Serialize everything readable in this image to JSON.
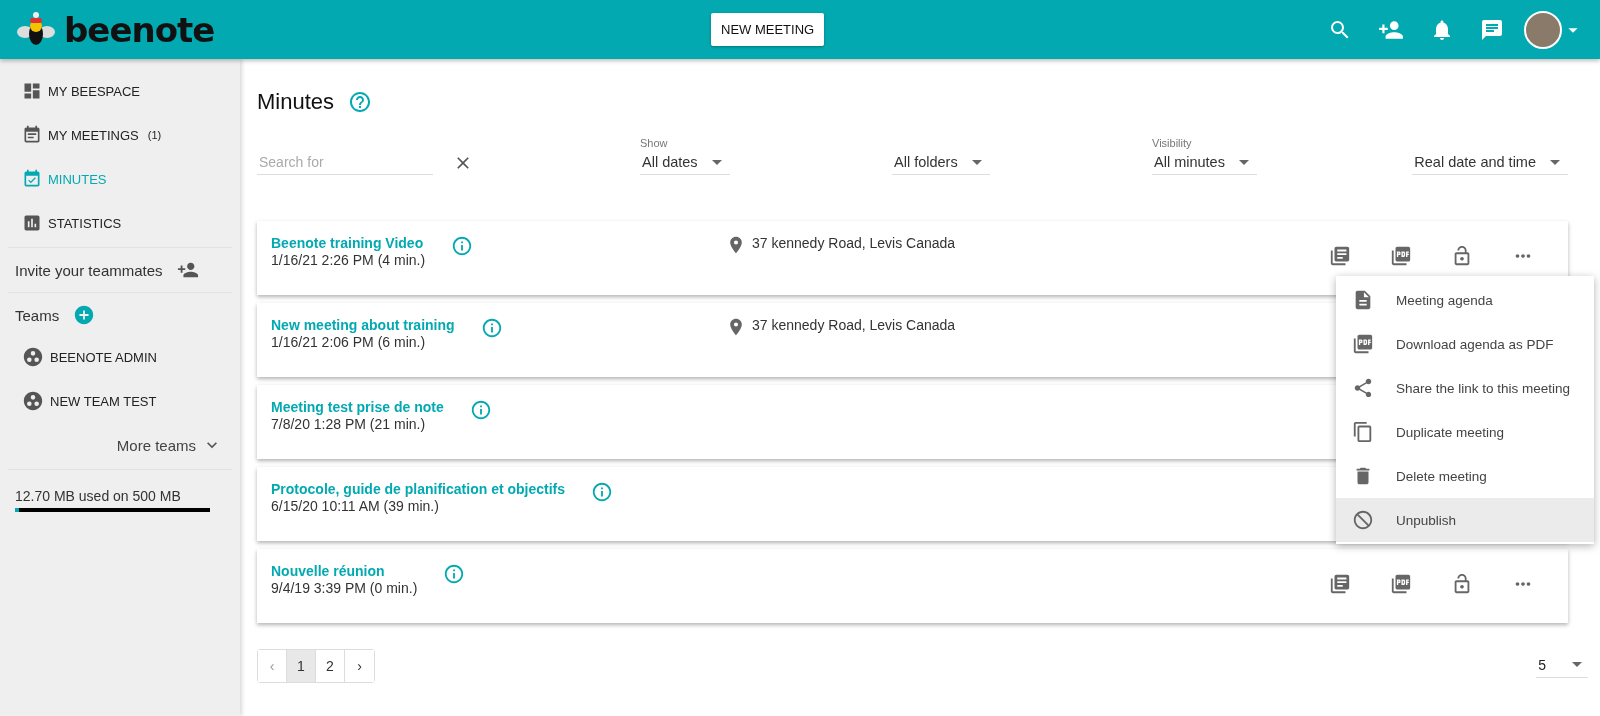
{
  "header": {
    "logo": "beenote",
    "new_meeting": "NEW MEETING"
  },
  "sidebar": {
    "nav": [
      {
        "kind": "space",
        "label": "MY BEESPACE",
        "selected": false
      },
      {
        "kind": "meetings",
        "label": "MY MEETINGS",
        "count": "(1)",
        "selected": false
      },
      {
        "kind": "minutes",
        "label": "MINUTES",
        "selected": true
      },
      {
        "kind": "stats",
        "label": "STATISTICS",
        "selected": false
      }
    ],
    "invite": "Invite your teammates",
    "teams_label": "Teams",
    "teams": [
      "BEENOTE ADMIN",
      "NEW TEAM TEST"
    ],
    "more_teams": "More teams",
    "storage": {
      "text": "12.70 MB used on 500 MB",
      "level": 0.02
    }
  },
  "page": {
    "title": "Minutes"
  },
  "filters": {
    "search": {
      "placeholder": "Search for"
    },
    "selects": [
      {
        "label": "Show",
        "value": "All dates"
      },
      {
        "value": "All folders"
      },
      {
        "label": "Visibility",
        "value": "All minutes"
      },
      {
        "value": "Real date and time"
      }
    ]
  },
  "meetings": [
    {
      "title": "Beenote training Video",
      "date": "1/16/21 2:26 PM (4 min.)",
      "location": "37 kennedy Road, Levis Canada",
      "actions": true
    },
    {
      "title": "New meeting about training",
      "date": "1/16/21 2:06 PM (6 min.)",
      "location": "37 kennedy Road, Levis Canada",
      "actions": false
    },
    {
      "title": "Meeting test prise de note",
      "date": "7/8/20 1:28 PM (21 min.)",
      "actions": false
    },
    {
      "title": "Protocole, guide de planification et objectifs",
      "date": "6/15/20 10:11 AM (39 min.)",
      "actions": false
    },
    {
      "title": "Nouvelle réunion",
      "date": "9/4/19 3:39 PM (0 min.)",
      "actions": true
    }
  ],
  "menu": [
    {
      "kind": "agenda",
      "label": "Meeting agenda",
      "selected": false
    },
    {
      "kind": "pdf",
      "label": "Download agenda as PDF",
      "selected": false
    },
    {
      "kind": "share",
      "label": "Share the link to this meeting",
      "selected": false
    },
    {
      "kind": "duplicate",
      "label": "Duplicate meeting",
      "selected": false
    },
    {
      "kind": "delete",
      "label": "Delete meeting",
      "selected": false
    },
    {
      "kind": "unpublish",
      "label": "Unpublish",
      "selected": true
    }
  ],
  "pagination": {
    "prev": "‹",
    "pages": [
      {
        "label": "1",
        "selected": true
      },
      {
        "label": "2",
        "selected": false
      }
    ],
    "next": "›"
  },
  "page_size": "5"
}
